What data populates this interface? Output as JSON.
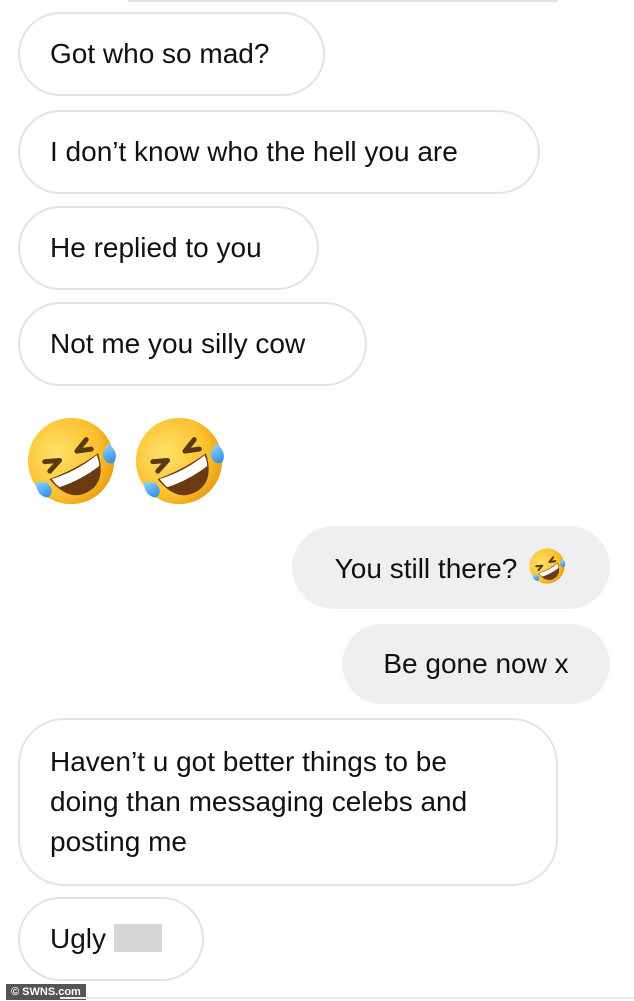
{
  "conversation": {
    "messages": [
      {
        "side": "incoming",
        "text": "Got who so mad?"
      },
      {
        "side": "incoming",
        "text": "I don’t know who the hell you are"
      },
      {
        "side": "incoming",
        "text": "He replied to you"
      },
      {
        "side": "incoming",
        "text": "Not me you silly cow"
      },
      {
        "side": "incoming",
        "emoji": [
          "rolling-on-floor-laughing-emoji",
          "rolling-on-floor-laughing-emoji"
        ]
      },
      {
        "side": "outgoing",
        "text": "You still there?",
        "emoji": "rolling-on-floor-laughing-emoji"
      },
      {
        "side": "outgoing",
        "text": "Be gone now x"
      },
      {
        "side": "incoming",
        "lines": [
          "Haven’t u got better things to be",
          "doing than messaging celebs and",
          "posting me"
        ]
      },
      {
        "side": "incoming",
        "text": "Ugly",
        "redacted": true
      }
    ]
  },
  "watermark": {
    "text": "© SWNS.com"
  },
  "colors": {
    "incoming_bubble_bg": "#ffffff",
    "incoming_bubble_border": "#e3e3e3",
    "outgoing_bubble_bg": "#efefef",
    "text": "#111111",
    "redaction": "#d6d6d6"
  }
}
